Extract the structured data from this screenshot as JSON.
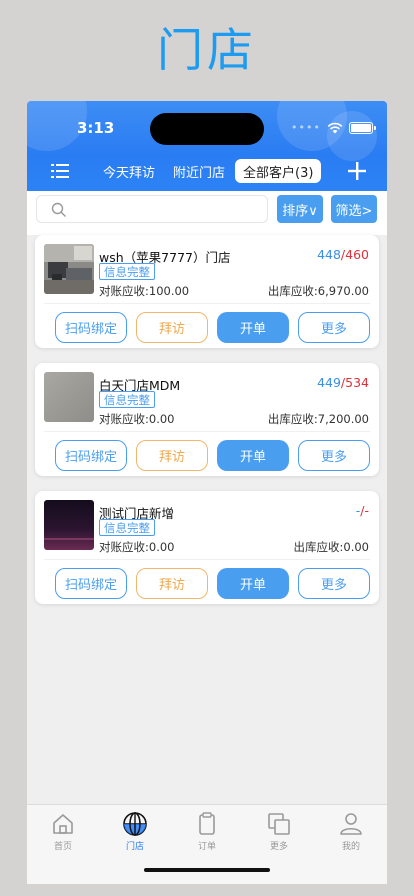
{
  "page_title": "门店",
  "status": {
    "time": "3:13"
  },
  "tabs": [
    {
      "label": "今天拜访"
    },
    {
      "label": "附近门店"
    },
    {
      "label": "全部客户(3)"
    }
  ],
  "search": {
    "placeholder": ""
  },
  "sort_label": "排序∨",
  "filter_label": "筛选>",
  "stores": [
    {
      "name": "wsh（苹果7777）门店",
      "count_a": "448",
      "count_b": "460",
      "badge": "信息完整",
      "recon_receivable": "对账应收:100.00",
      "outbound_receivable": "出库应收:6,970.00"
    },
    {
      "name": "白天门店MDM",
      "count_a": "449",
      "count_b": "534",
      "badge": "信息完整",
      "recon_receivable": "对账应收:0.00",
      "outbound_receivable": "出库应收:7,200.00"
    },
    {
      "name": "测试门店新增",
      "count_a": "-",
      "count_b": "-",
      "badge": "信息完整",
      "recon_receivable": "对账应收:0.00",
      "outbound_receivable": "出库应收:0.00"
    }
  ],
  "actions": {
    "scan": "扫码绑定",
    "visit": "拜访",
    "order": "开单",
    "more": "更多"
  },
  "nav": [
    {
      "label": "首页",
      "icon": "home-icon"
    },
    {
      "label": "门店",
      "icon": "globe-icon"
    },
    {
      "label": "订单",
      "icon": "clipboard-icon"
    },
    {
      "label": "更多",
      "icon": "stack-icon"
    },
    {
      "label": "我的",
      "icon": "person-icon"
    }
  ],
  "colors": {
    "accent": "#2a7cf2",
    "button_blue": "#4a9ef0",
    "count_red": "#e0303a",
    "visit_orange": "#f0a84e"
  }
}
